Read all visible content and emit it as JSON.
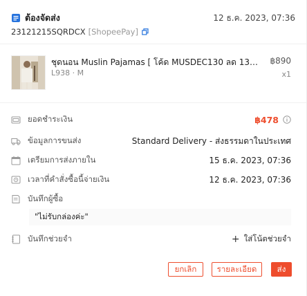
{
  "order": {
    "status": "ต้องจัดส่ง",
    "date": "12 ธ.ค. 2023, 07:36",
    "order_sn": "23121215SQRDCX",
    "payment_method": "[ShopeePay]"
  },
  "product": {
    "name": "ชุดนอน Muslin Pajamas [ โค้ด MUSDEC130 ลด 130 ...",
    "variant": "L938 · M",
    "price": "฿890",
    "quantity": "x1"
  },
  "details": {
    "total_label": "ยอดชำระเงิน",
    "total_value": "฿478",
    "shipping_label": "ข้อมูลการขนส่ง",
    "shipping_value": "Standard Delivery - ส่งธรรมดาในประเทศ",
    "prepare_label": "เตรียมการส่งภายใน",
    "prepare_value": "15 ธ.ค. 2023, 07:36",
    "order_time_label": "เวลาที่คำสั่งซื้อนี้จ่ายเงิน",
    "order_time_value": "12 ธ.ค. 2023, 07:36",
    "buyer_note_label": "บันทึกผู้ซื้อ",
    "buyer_note_value": "\"ไม่รับกล่องค่ะ\"",
    "seller_note_label": "บันทึกช่วยจำ",
    "add_note_label": "ใส่โน้ตช่วยจำ"
  },
  "actions": {
    "cancel": "ยกเลิก",
    "details": "รายละเอียด",
    "ship": "ส่ง"
  },
  "colors": {
    "accent": "#ee4d2d",
    "status_icon": "#2673dd"
  }
}
